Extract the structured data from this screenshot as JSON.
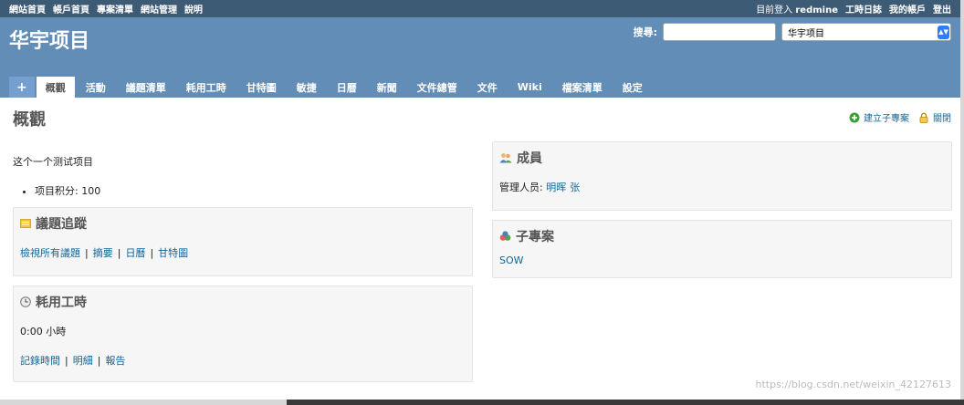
{
  "top_menu": {
    "left": [
      "網站首頁",
      "帳戶首頁",
      "專案清單",
      "網站管理",
      "說明"
    ],
    "login_prefix": "目前登入",
    "login_user": "redmine",
    "right": [
      "工時日誌",
      "我的帳戶",
      "登出"
    ]
  },
  "header": {
    "project_title": "华宇项目",
    "search_label": "搜尋:",
    "project_select_value": "华宇项目"
  },
  "main_menu": {
    "new": "+",
    "tabs": [
      "概觀",
      "活動",
      "議題清單",
      "耗用工時",
      "甘特圖",
      "敏捷",
      "日曆",
      "新聞",
      "文件總管",
      "文件",
      "Wiki",
      "檔案清單",
      "設定"
    ],
    "selected": "概觀"
  },
  "content": {
    "heading": "概觀",
    "contextual": {
      "add_subproject": "建立子專案",
      "close": "關閉"
    },
    "description": "这个一个测试项目",
    "custom_field": "项目积分: 100"
  },
  "issues_box": {
    "title": "議題追蹤",
    "links": [
      "檢視所有議題",
      "摘要",
      "日曆",
      "甘特圖"
    ]
  },
  "time_box": {
    "title": "耗用工時",
    "spent": "0:00 小時",
    "links": [
      "記錄時間",
      "明細",
      "報告"
    ]
  },
  "members_box": {
    "title": "成員",
    "role": "管理人员:",
    "members": [
      "明晖",
      "张"
    ]
  },
  "subprojects_box": {
    "title": "子專案",
    "items": [
      "SOW"
    ]
  },
  "watermark": "https://blog.csdn.net/weixin_42127613",
  "colors": {
    "top_menu_bg": "#3e5b76",
    "header_bg": "#628db6",
    "link": "#116699",
    "box_bg": "#f6f6f6"
  }
}
